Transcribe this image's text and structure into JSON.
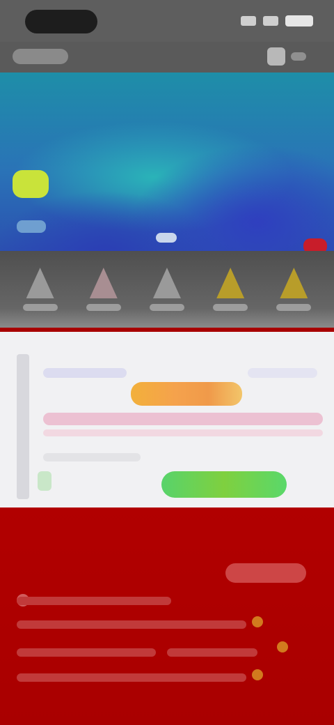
{
  "status_bar": {
    "time": "",
    "icons": [
      "signal-icon",
      "wifi-icon",
      "battery-icon"
    ]
  },
  "header": {
    "back_label": "",
    "action_label": "",
    "action_icon": "share-icon"
  },
  "banner": {
    "badge_label": "",
    "subtitle": ""
  },
  "categories": [
    {
      "label": "",
      "icon": "category-icon"
    },
    {
      "label": "",
      "icon": "category-icon"
    },
    {
      "label": "",
      "icon": "category-icon"
    },
    {
      "label": "",
      "icon": "category-icon"
    },
    {
      "label": "",
      "icon": "category-icon"
    }
  ],
  "card": {
    "title": "",
    "highlight_text": "",
    "description": "",
    "note": "",
    "cta_label": ""
  },
  "promo": {
    "button_label": "",
    "lines": [
      "",
      "",
      "",
      ""
    ]
  },
  "colors": {
    "banner_top": "#1e8ea8",
    "banner_bottom": "#2b50b0",
    "badge": "#c9e33a",
    "highlight": "#f2b03b",
    "cta": "#58d36b",
    "promo_bg": "#a90000"
  }
}
